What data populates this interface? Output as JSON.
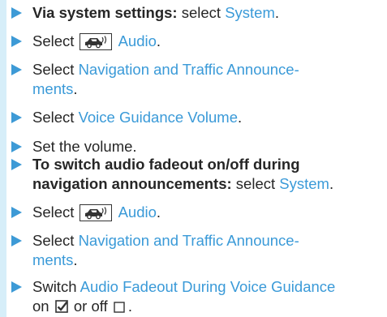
{
  "steps": [
    {
      "lead": "Via system settings:",
      "after_lead": " select ",
      "link": "System",
      "tail": "."
    },
    {
      "pre": "Select ",
      "icon": "car-audio-icon",
      "link": "Audio",
      "tail": "."
    },
    {
      "pre": "Select ",
      "link_line1": "Navigation and Traffic Announce-",
      "link_line2": "ments",
      "tail": "."
    },
    {
      "pre": "Select ",
      "link": "Voice Guidance Volume",
      "tail": "."
    },
    {
      "plain": "Set the volume."
    },
    {
      "lead_line1": "To switch audio fadeout on/off during",
      "lead_line2": "navigation announcements:",
      "after_lead": " select ",
      "link": "System",
      "tail": "."
    },
    {
      "pre": "Select ",
      "icon": "car-audio-icon",
      "link": "Audio",
      "tail": "."
    },
    {
      "pre": "Select ",
      "link_line1": "Navigation and Traffic Announce-",
      "link_line2": "ments",
      "tail": "."
    },
    {
      "pre": "Switch ",
      "link": "Audio Fadeout During Voice Guidance",
      "line2_pre": "on ",
      "on_icon": "checkbox-checked-icon",
      "line2_mid": " or off ",
      "off_icon": "checkbox-empty-icon",
      "line2_tail": "."
    }
  ],
  "colors": {
    "accent": "#3a9ad8",
    "bullet": "#3d9ad6",
    "side_bar": "#d6eef9",
    "text": "#262626"
  }
}
